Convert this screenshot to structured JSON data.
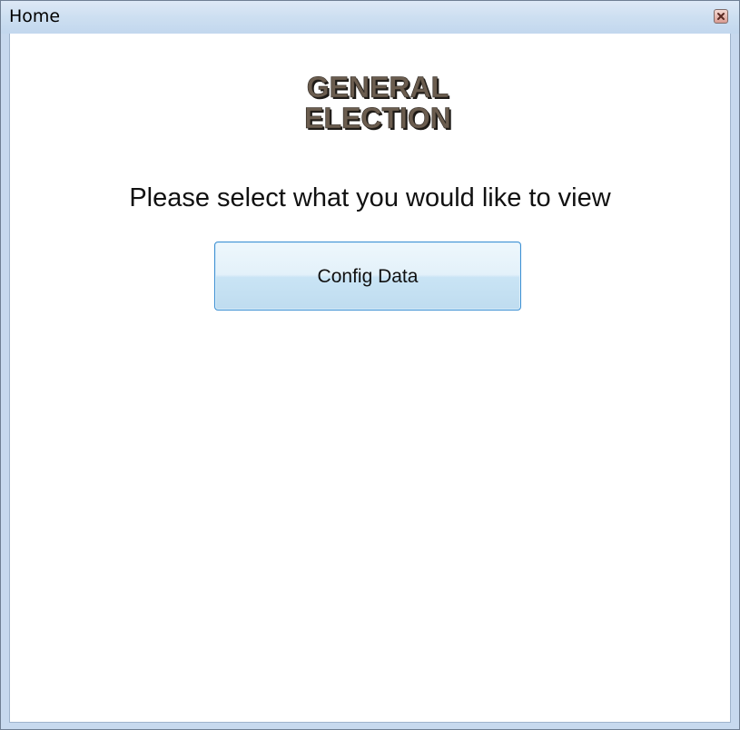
{
  "window": {
    "title": "Home"
  },
  "logo": {
    "line1": "GENERAL",
    "line2": "ELECTION"
  },
  "main": {
    "prompt": "Please select what you would like to view",
    "config_button_label": "Config Data"
  },
  "colors": {
    "titlebar": "#cddff1",
    "button_border": "#3c8fd2",
    "logo_text": "#6b5d4f"
  },
  "icons": {
    "close": "close-icon"
  }
}
